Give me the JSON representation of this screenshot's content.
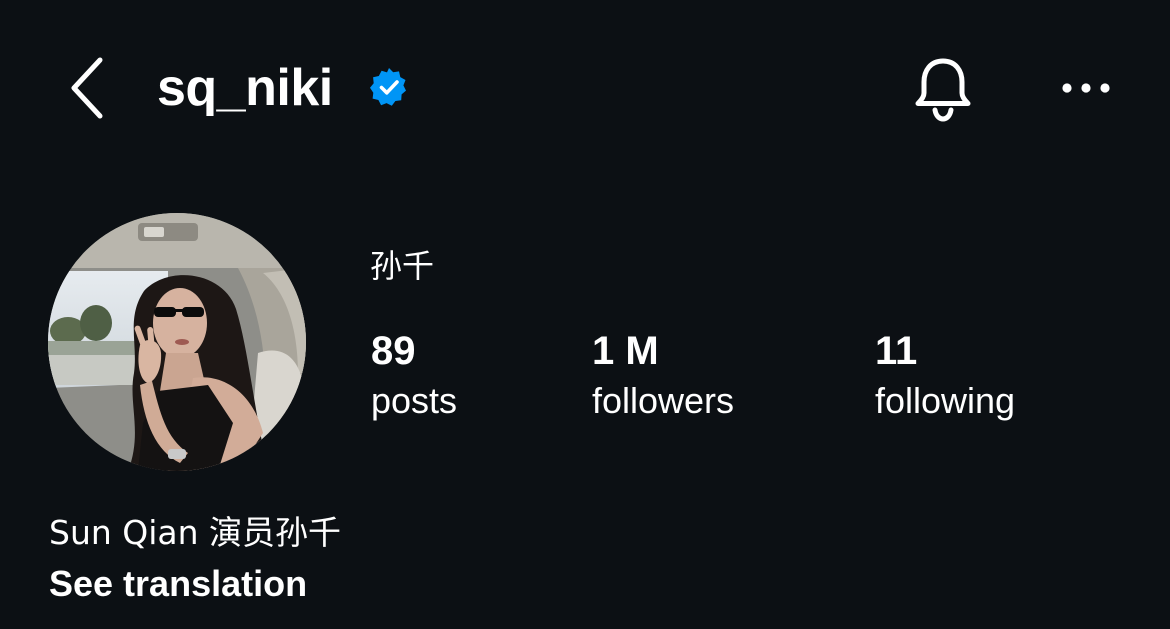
{
  "header": {
    "username": "sq_niki",
    "verified": true,
    "icons": {
      "back": "chevron-left-icon",
      "verified": "verified-badge-icon",
      "notifications": "bell-icon",
      "more": "more-horizontal-icon"
    }
  },
  "profile": {
    "display_name": "孙千",
    "avatar": "profile-photo",
    "stats": {
      "posts": {
        "value": "89",
        "label": "posts"
      },
      "followers": {
        "value": "1 M",
        "label": "followers"
      },
      "following": {
        "value": "11",
        "label": "following"
      }
    },
    "bio": "Sun Qian 演员孙千",
    "see_translation": "See translation"
  },
  "colors": {
    "background": "#0c1014",
    "text": "#ffffff",
    "verified_blue": "#0095f6"
  }
}
